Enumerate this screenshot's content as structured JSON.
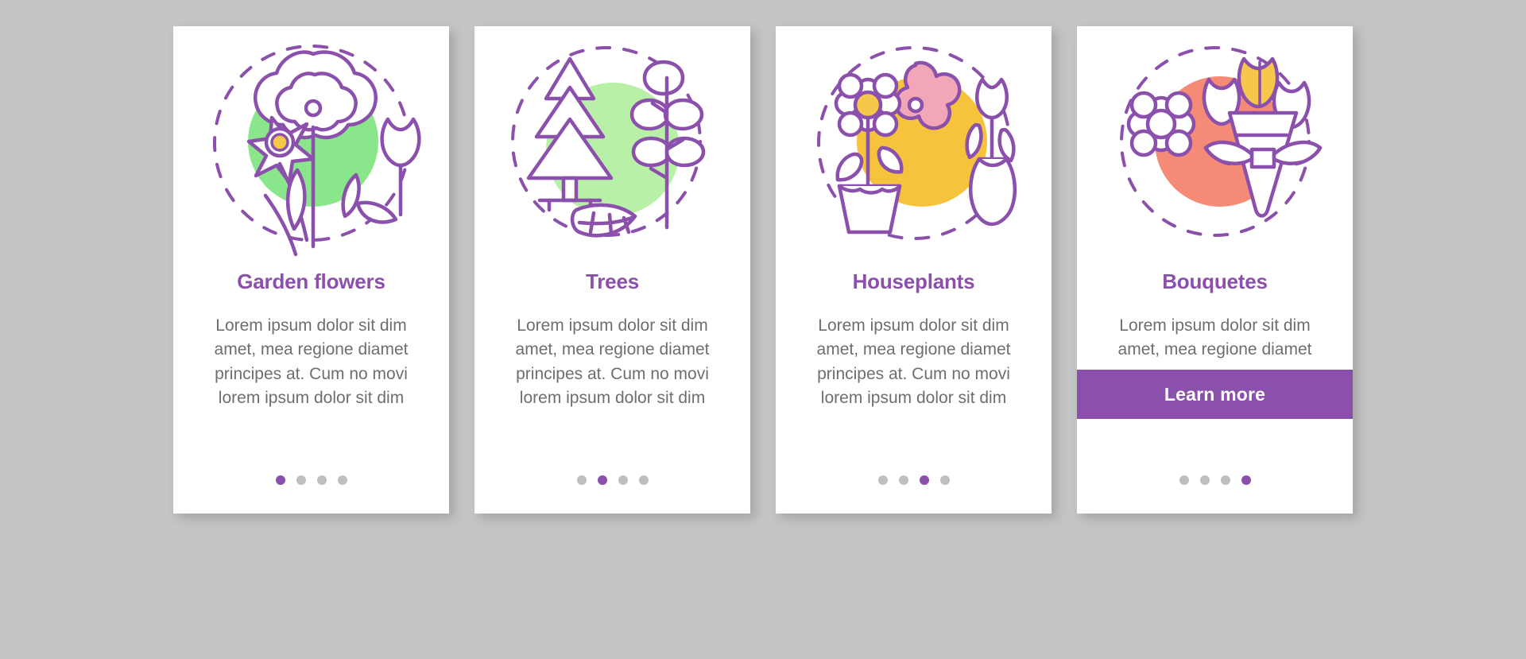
{
  "page": {
    "background_color": "#c4c4c4",
    "accent_color": "#8b4fac",
    "body_text_color": "#6e6e6e",
    "dot_inactive_color": "#bfbfbf"
  },
  "cards": [
    {
      "id": "garden-flowers",
      "title": "Garden flowers",
      "body": "Lorem ipsum dolor sit dim amet, mea regione diamet principes at. Cum no movi lorem ipsum dolor sit dim",
      "illustration": {
        "name": "garden-flowers-illustration",
        "blob_color": "#8ae68a",
        "accent_color": "#f5c84c",
        "line_color": "#8b4fac"
      },
      "dots": {
        "count": 4,
        "active_index": 0
      },
      "cta": null
    },
    {
      "id": "trees",
      "title": "Trees",
      "body": "Lorem ipsum dolor sit dim amet, mea regione diamet principes at. Cum no movi lorem ipsum dolor sit dim",
      "illustration": {
        "name": "trees-illustration",
        "blob_color": "#8ae68a",
        "accent_color": "#8ae68a",
        "line_color": "#8b4fac"
      },
      "dots": {
        "count": 4,
        "active_index": 1
      },
      "cta": null
    },
    {
      "id": "houseplants",
      "title": "Houseplants",
      "body": "Lorem ipsum dolor sit dim amet, mea regione diamet principes at. Cum no movi lorem ipsum dolor sit dim",
      "illustration": {
        "name": "houseplants-illustration",
        "blob_color": "#f5c33c",
        "accent_color": "#f2a7b8",
        "line_color": "#8b4fac"
      },
      "dots": {
        "count": 4,
        "active_index": 2
      },
      "cta": null
    },
    {
      "id": "bouquetes",
      "title": "Bouquetes",
      "body": "Lorem ipsum dolor sit dim amet, mea regione diamet",
      "illustration": {
        "name": "bouquetes-illustration",
        "blob_color": "#f58a76",
        "accent_color": "#f5c84c",
        "line_color": "#8b4fac"
      },
      "dots": {
        "count": 4,
        "active_index": 3
      },
      "cta": {
        "label": "Learn more"
      }
    }
  ]
}
